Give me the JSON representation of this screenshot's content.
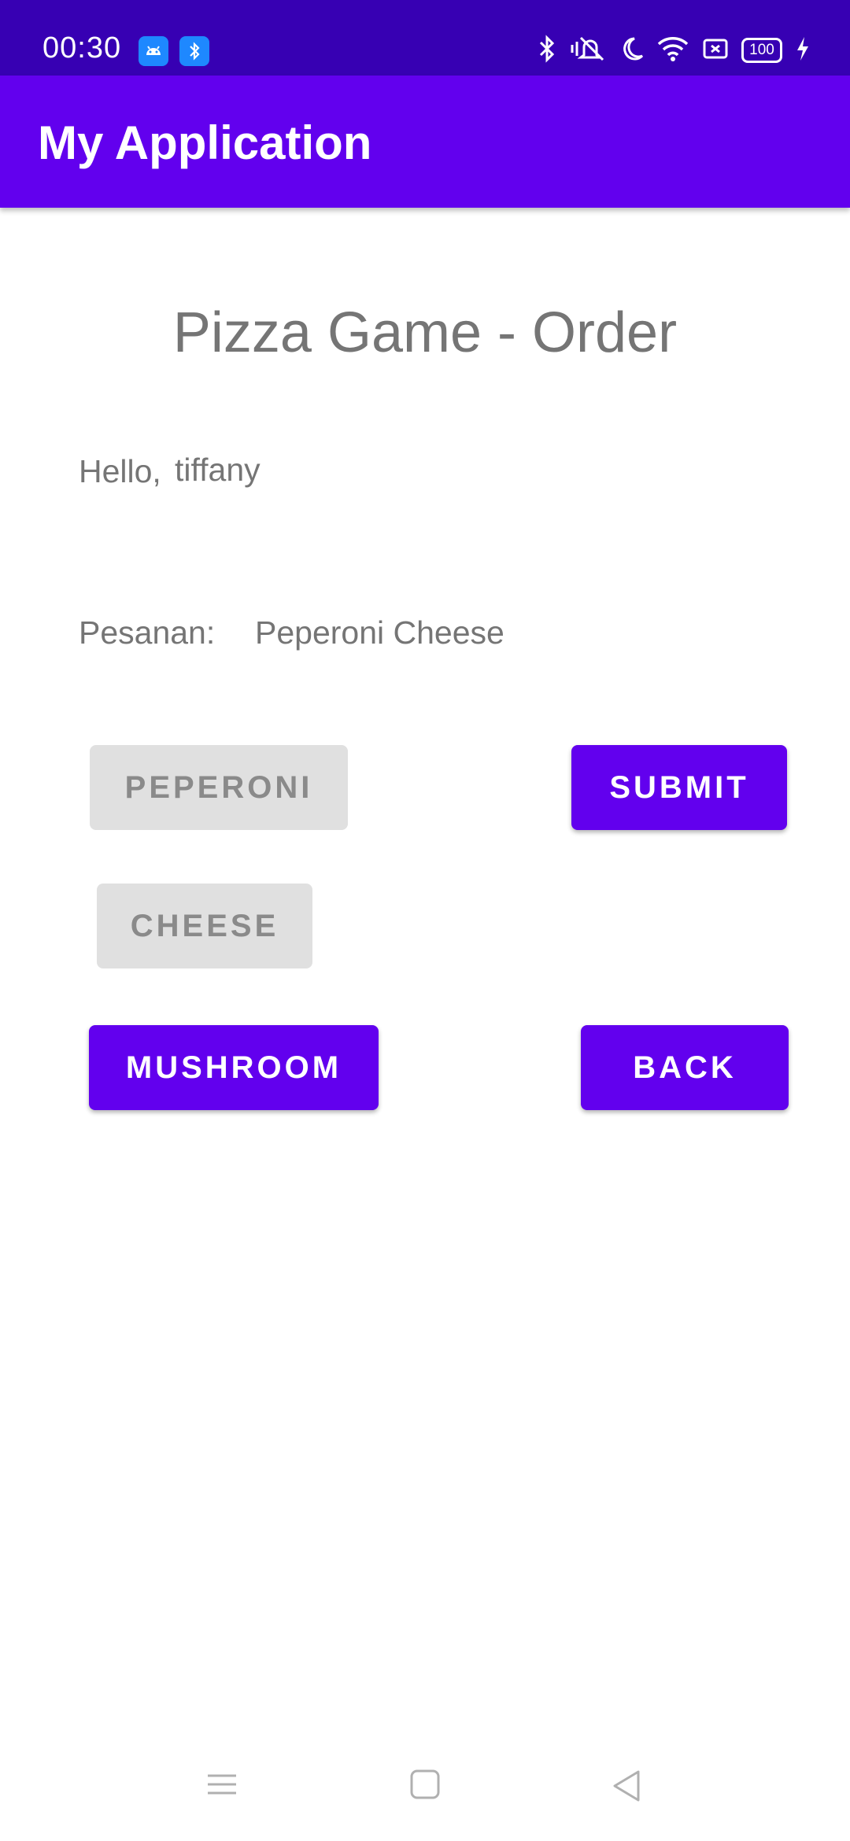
{
  "status_bar": {
    "time": "00:30",
    "battery_level": "100",
    "icons": [
      "android-notification-icon",
      "bluetooth-notification-icon",
      "bluetooth-icon",
      "vibrate-off-icon",
      "do-not-disturb-moon-icon",
      "wifi-icon",
      "screen-record-icon",
      "battery-icon",
      "charging-bolt-icon"
    ]
  },
  "app_bar": {
    "title": "My Application"
  },
  "main": {
    "title": "Pizza Game - Order",
    "greeting_label": "Hello,",
    "username": "tiffany",
    "order_label": "Pesanan:",
    "order_value": "Peperoni Cheese",
    "buttons": {
      "peperoni": "PEPERONI",
      "submit": "SUBMIT",
      "cheese": "CHEESE",
      "mushroom": "MUSHROOM",
      "back": "BACK"
    }
  },
  "nav_bar": {
    "icons": [
      "menu-icon",
      "home-icon",
      "back-triangle-icon"
    ]
  },
  "colors": {
    "primary": "#6200ee",
    "primary_dark": "#3700b3",
    "disabled_button": "#e0e0e0",
    "text_gray": "#757575"
  }
}
